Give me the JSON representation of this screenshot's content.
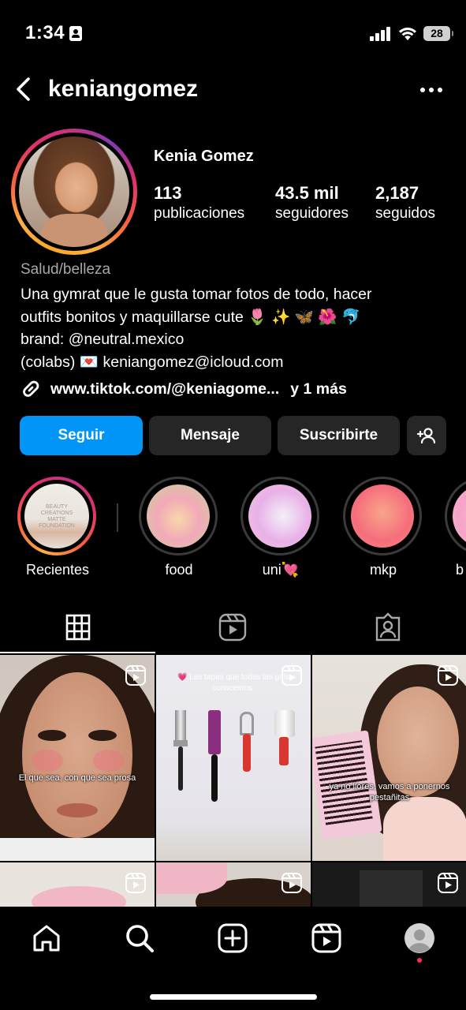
{
  "status_bar": {
    "time": "1:34",
    "battery": "28",
    "icons": [
      "contact-card-icon",
      "cellular-signal-icon",
      "wifi-icon",
      "battery-icon"
    ]
  },
  "header": {
    "username": "keniangomez",
    "icons": [
      "back-icon",
      "more-icon"
    ]
  },
  "profile": {
    "display_name": "Kenia Gomez",
    "stats": [
      {
        "value": "113",
        "label": "publicaciones"
      },
      {
        "value": "43.5 mil",
        "label": "seguidores"
      },
      {
        "value": "2,187",
        "label": "seguidos"
      }
    ],
    "category": "Salud/belleza",
    "bio_lines": [
      "Una gymrat que le gusta tomar fotos de todo, hacer",
      "outfits bonitos y maquillarse cute 🌷 ✨ 🦋 🌺 🐬",
      "brand: @neutral.mexico",
      "(colabs) 💌  keniangomez@icloud.com"
    ],
    "link": {
      "url": "www.tiktok.com/@keniagome...",
      "more": "y 1 más"
    }
  },
  "actions": {
    "follow": "Seguir",
    "message": "Mensaje",
    "subscribe": "Suscribirte",
    "add_user_icon": "add-person-icon"
  },
  "highlights": [
    {
      "label": "Recientes",
      "kind": "story",
      "story_text": "BEAUTY CREATIONS  MATTE FOUNDATION"
    },
    {
      "label": "food",
      "colors": [
        "#f7d8a8",
        "#f2a9b8",
        "#c9d39a"
      ]
    },
    {
      "label": "uni💘",
      "colors": [
        "#f3f0f7",
        "#e9b0e8",
        "#f5c5dd"
      ]
    },
    {
      "label": "mkp",
      "colors": [
        "#f9a58a",
        "#f56d7c",
        "#ff8c7a"
      ]
    },
    {
      "label": "b",
      "colors": [
        "#f5b6cf",
        "#f6a3c8",
        "#f1c1d6"
      ]
    }
  ],
  "tabs": [
    {
      "name": "tab-posts-grid",
      "icon": "grid-icon",
      "active": true
    },
    {
      "name": "tab-reels",
      "icon": "reels-icon",
      "active": false
    },
    {
      "name": "tab-tagged",
      "icon": "tagged-person-icon",
      "active": false
    }
  ],
  "posts": [
    {
      "caption": "El que sea, con que sea prosa",
      "type": "reel"
    },
    {
      "caption": "💗 Las tapas que todas las girls conocemos:",
      "type": "reel"
    },
    {
      "caption": "ya no llores, vamos a ponernos pestañitas",
      "type": "reel"
    },
    {
      "caption": "",
      "type": "reel"
    },
    {
      "caption": "",
      "type": "reel"
    },
    {
      "caption": "",
      "type": "reel"
    }
  ],
  "bottom_nav": [
    "home-icon",
    "search-icon",
    "create-icon",
    "reels-icon",
    "profile-icon"
  ]
}
